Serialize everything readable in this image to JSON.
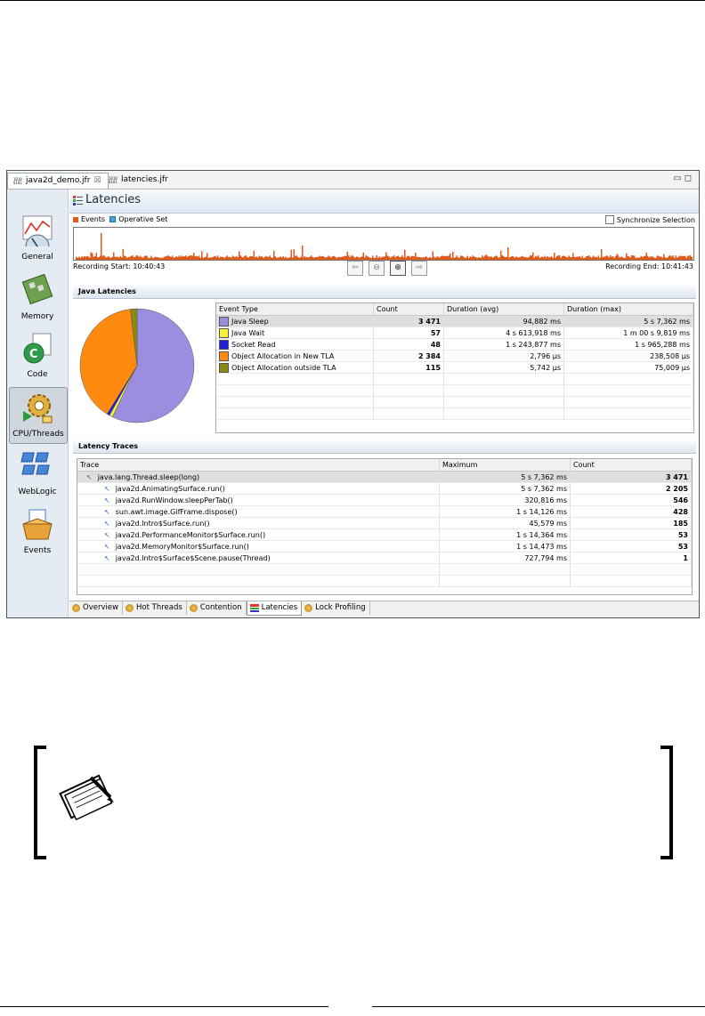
{
  "editor_tabs": [
    {
      "label": "java2d_demo.jfr"
    },
    {
      "label": "latencies.jfr"
    }
  ],
  "sidebar": {
    "items": [
      {
        "label": "General"
      },
      {
        "label": "Memory"
      },
      {
        "label": "Code"
      },
      {
        "label": "CPU/Threads",
        "selected": true
      },
      {
        "label": "WebLogic"
      },
      {
        "label": "Events"
      }
    ]
  },
  "header": {
    "title": "Latencies"
  },
  "range": {
    "legend_events": "Events",
    "legend_operative": "Operative Set",
    "sync_label": "Synchronize Selection",
    "recording_start": "Recording Start: 10:40:43",
    "recording_end": "Recording End: 10:41:43"
  },
  "java_latencies": {
    "title": "Java Latencies",
    "columns": [
      "Event Type",
      "Count",
      "Duration (avg)",
      "Duration (max)"
    ],
    "rows": [
      {
        "name": "Java Sleep",
        "color": "#9b8ee0",
        "count": "3 471",
        "avg": "94,882 ms",
        "max": "5 s 7,362 ms"
      },
      {
        "name": "Java Wait",
        "color": "#f5f03a",
        "count": "57",
        "avg": "4 s 613,918 ms",
        "max": "1 m 00 s 9,819 ms"
      },
      {
        "name": "Socket Read",
        "color": "#1f1fd6",
        "count": "48",
        "avg": "1 s 243,877 ms",
        "max": "1 s 965,288 ms"
      },
      {
        "name": "Object Allocation in New TLA",
        "color": "#ff8a10",
        "count": "2 384",
        "avg": "2,796 µs",
        "max": "238,508 µs"
      },
      {
        "name": "Object Allocation outside TLA",
        "color": "#8a8a10",
        "count": "115",
        "avg": "5,742 µs",
        "max": "75,009 µs"
      }
    ]
  },
  "chart_data": {
    "type": "pie",
    "labels": [
      "Java Sleep",
      "Java Wait",
      "Socket Read",
      "Object Allocation in New TLA",
      "Object Allocation outside TLA"
    ],
    "values": [
      3471,
      57,
      48,
      2384,
      115
    ],
    "colors": [
      "#9b8ee0",
      "#f5f03a",
      "#1f1fd6",
      "#ff8a10",
      "#8a8a10"
    ]
  },
  "latency_traces": {
    "title": "Latency Traces",
    "columns": [
      "Trace",
      "Maximum",
      "Count"
    ],
    "rows": [
      {
        "trace": "java.lang.Thread.sleep(long)",
        "max": "5 s 7,362 ms",
        "count": "3 471",
        "indent": 0
      },
      {
        "trace": "java2d.AnimatingSurface.run()",
        "max": "5 s 7,362 ms",
        "count": "2 205",
        "indent": 1
      },
      {
        "trace": "java2d.RunWindow.sleepPerTab()",
        "max": "320,816 ms",
        "count": "546",
        "indent": 1
      },
      {
        "trace": "sun.awt.image.GifFrame.dispose()",
        "max": "1 s 14,126 ms",
        "count": "428",
        "indent": 1
      },
      {
        "trace": "java2d.Intro$Surface.run()",
        "max": "45,579 ms",
        "count": "185",
        "indent": 1
      },
      {
        "trace": "java2d.PerformanceMonitor$Surface.run()",
        "max": "1 s 14,364 ms",
        "count": "53",
        "indent": 1
      },
      {
        "trace": "java2d.MemoryMonitor$Surface.run()",
        "max": "1 s 14,473 ms",
        "count": "53",
        "indent": 1
      },
      {
        "trace": "java2d.Intro$Surface$Scene.pause(Thread)",
        "max": "727,794 ms",
        "count": "1",
        "indent": 1
      }
    ]
  },
  "bottom_tabs": [
    {
      "label": "Overview"
    },
    {
      "label": "Hot Threads"
    },
    {
      "label": "Contention"
    },
    {
      "label": "Latencies",
      "active": true
    },
    {
      "label": "Lock Profiling"
    }
  ],
  "colors": {
    "events": "#e05a1c",
    "operative": "#4aa3d8",
    "accent": "#1e2a3a"
  }
}
